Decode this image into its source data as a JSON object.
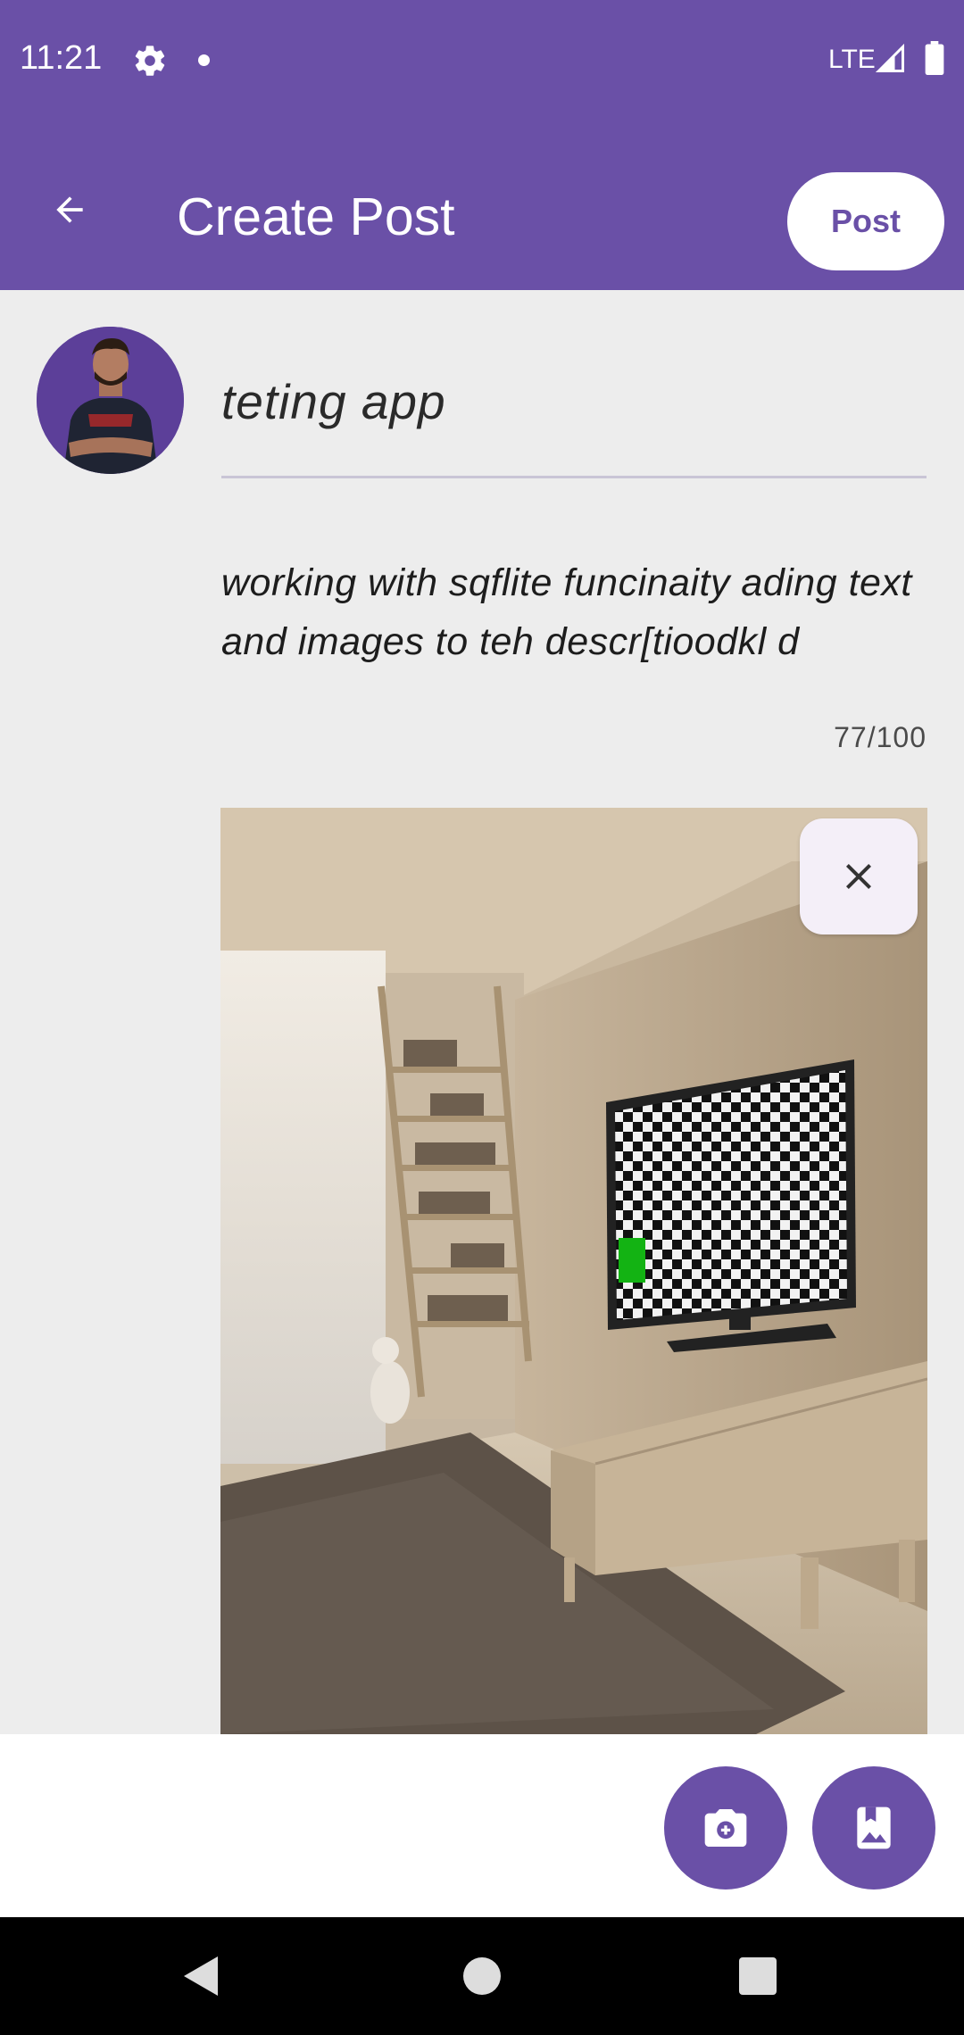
{
  "status_bar": {
    "time": "11:21",
    "network": "LTE",
    "icons": [
      "gear-icon",
      "notification-dot-icon",
      "signal-icon",
      "battery-icon"
    ]
  },
  "app_bar": {
    "title": "Create Post",
    "back_icon": "arrow-left-icon",
    "post_label": "Post"
  },
  "form": {
    "title_value": "teting app",
    "description_value": "working with sqflite funcinaity ading text and images to teh descr[tioodkl d",
    "char_count": "77/100"
  },
  "attachment": {
    "remove_icon": "close-icon"
  },
  "actions": {
    "camera_icon": "camera-icon",
    "gallery_icon": "gallery-icon"
  },
  "colors": {
    "primary": "#6a50a7",
    "background": "#ededed",
    "surface": "#ffffff",
    "remove_button_bg": "#f4eff8"
  }
}
